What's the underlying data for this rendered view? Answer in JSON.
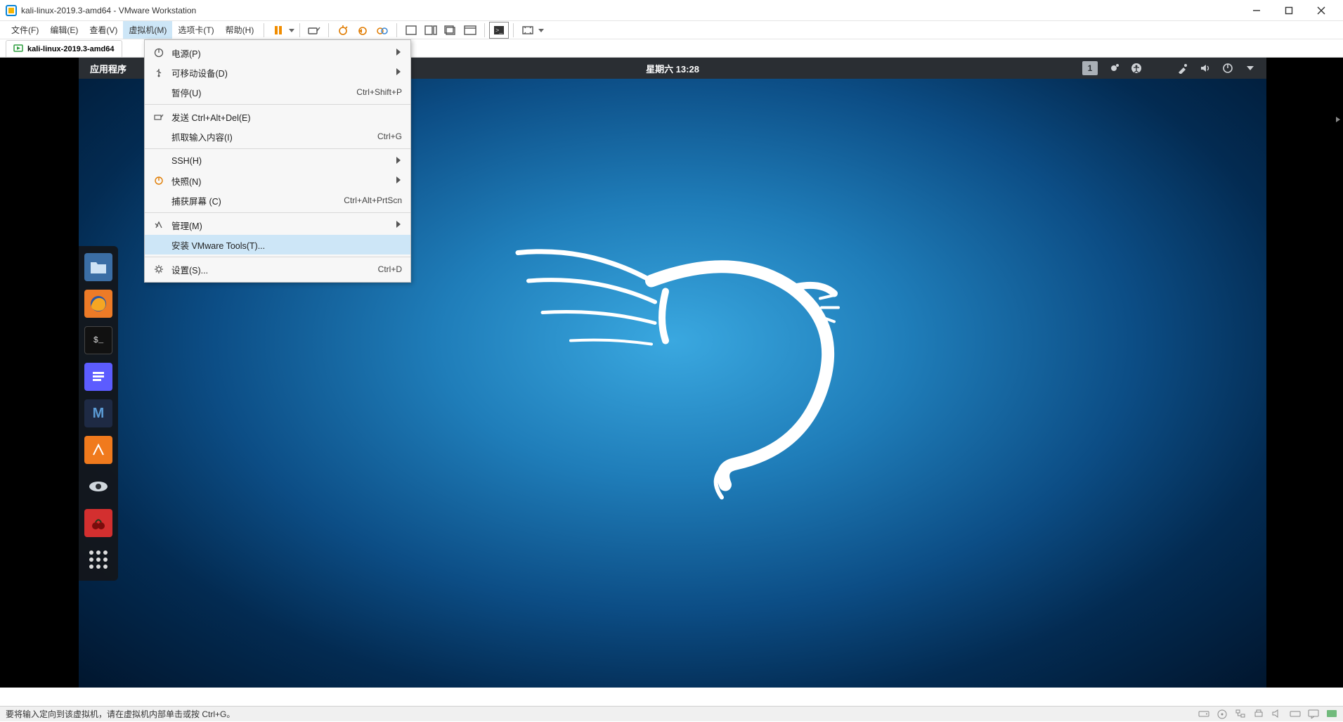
{
  "window": {
    "title": "kali-linux-2019.3-amd64 - VMware Workstation"
  },
  "menubar": {
    "items": [
      "文件(F)",
      "编辑(E)",
      "查看(V)",
      "虚拟机(M)",
      "选项卡(T)",
      "帮助(H)"
    ],
    "active_index": 3
  },
  "vm_tab": {
    "label": "kali-linux-2019.3-amd64"
  },
  "dropdown": {
    "rows": [
      {
        "icon": "power",
        "label": "电源(P)",
        "shortcut": "",
        "submenu": true
      },
      {
        "icon": "usb",
        "label": "可移动设备(D)",
        "shortcut": "",
        "submenu": true
      },
      {
        "icon": "",
        "label": "暂停(U)",
        "shortcut": "Ctrl+Shift+P",
        "submenu": false
      },
      {
        "sep": true
      },
      {
        "icon": "send",
        "label": "发送 Ctrl+Alt+Del(E)",
        "shortcut": "",
        "submenu": false
      },
      {
        "icon": "",
        "label": "抓取输入内容(I)",
        "shortcut": "Ctrl+G",
        "submenu": false
      },
      {
        "sep": true
      },
      {
        "icon": "",
        "label": "SSH(H)",
        "shortcut": "",
        "submenu": true
      },
      {
        "icon": "snapshot",
        "label": "快照(N)",
        "shortcut": "",
        "submenu": true
      },
      {
        "icon": "",
        "label": "捕获屏幕 (C)",
        "shortcut": "Ctrl+Alt+PrtScn",
        "submenu": false
      },
      {
        "sep": true
      },
      {
        "icon": "manage",
        "label": "管理(M)",
        "shortcut": "",
        "submenu": true
      },
      {
        "icon": "",
        "label": "安装 VMware Tools(T)...",
        "shortcut": "",
        "submenu": false,
        "highlight": true
      },
      {
        "sep": true
      },
      {
        "icon": "gear",
        "label": "设置(S)...",
        "shortcut": "Ctrl+D",
        "submenu": false
      }
    ]
  },
  "kali": {
    "apps_label": "应用程序",
    "clock": "星期六 13:28",
    "workspace": "1"
  },
  "statusbar": {
    "hint": "要将输入定向到该虚拟机，请在虚拟机内部单击或按 Ctrl+G。"
  }
}
